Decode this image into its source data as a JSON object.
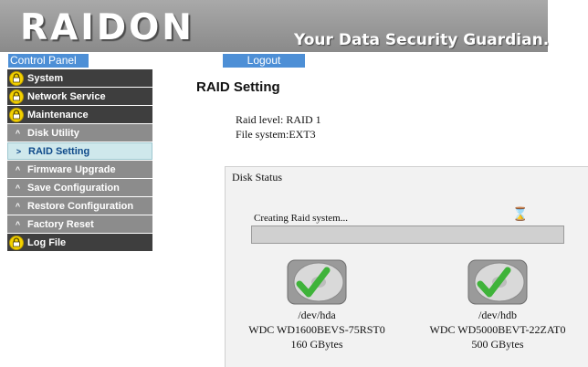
{
  "header": {
    "brand": "RAIDON",
    "tagline": "Your Data Security Guardian."
  },
  "topbar": {
    "control_panel": "Control Panel",
    "logout": "Logout"
  },
  "sidebar": {
    "items": [
      {
        "label": "System"
      },
      {
        "label": "Network Service"
      },
      {
        "label": "Maintenance"
      },
      {
        "label": "Disk Utility"
      },
      {
        "label": "RAID Setting"
      },
      {
        "label": "Firmware Upgrade"
      },
      {
        "label": "Save Configuration"
      },
      {
        "label": "Restore Configuration"
      },
      {
        "label": "Factory Reset"
      },
      {
        "label": "Log File"
      }
    ]
  },
  "main": {
    "title": "RAID Setting",
    "raid_level_label": "Raid level:",
    "raid_level_value": "RAID 1",
    "file_system_label": "File system:",
    "file_system_value": "EXT3",
    "disk_status": {
      "title": "Disk Status",
      "progress_text": "Creating Raid system...",
      "progress_fraction": 0.0,
      "disks": [
        {
          "device": "/dev/hda",
          "model": "WDC WD1600BEVS-75RST0",
          "size": "160 GBytes",
          "status_icon": "check-icon"
        },
        {
          "device": "/dev/hdb",
          "model": "WDC WD5000BEVT-22ZAT0",
          "size": "500 GBytes",
          "status_icon": "check-icon"
        }
      ]
    }
  },
  "colors": {
    "accent": "#4d8fd6",
    "sidebar_dark": "#3e3e3e",
    "sidebar_sub": "#8c8c8c",
    "active_bg": "#cfe8ec",
    "check": "#3fb33a"
  }
}
